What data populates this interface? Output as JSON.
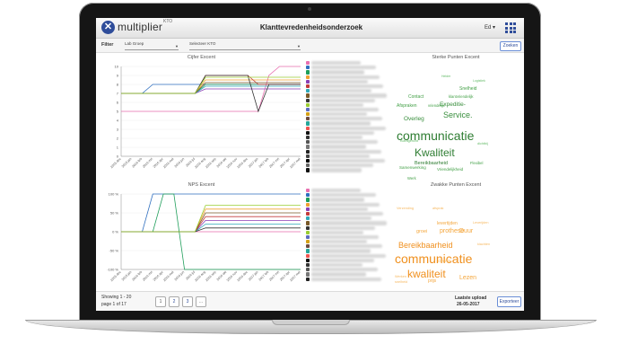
{
  "app": {
    "logo_letter": "✕",
    "logo_name": "multiplier",
    "logo_sup": "KTO",
    "title": "Klanttevredenheidsonderzoek",
    "user": "Ed ▾"
  },
  "filter": {
    "label": "Filter",
    "select1": "Lab Groep",
    "select2": "Selecteer KTO",
    "zoom_button": "Zoeken"
  },
  "panels": {
    "top_left_title": "Cijfer Excent",
    "top_right_title": "Sterke Punten Excent",
    "bottom_left_title": "NPS Excent",
    "bottom_right_title": "Zwakke Punten Excent"
  },
  "chart_data": [
    {
      "type": "line",
      "title": "Cijfer Excent",
      "x": [
        "2015 dec",
        "2015 jan",
        "2016 feb",
        "2016 mrt",
        "2016 apr",
        "2016 mei",
        "2016 jun",
        "2016 jul",
        "2016 aug",
        "2016 sep",
        "2016 okt",
        "2016 nov",
        "2016 dec",
        "2017 jan",
        "2017 feb",
        "2017 mrt",
        "2017 apr",
        "2017 mei"
      ],
      "ylim": [
        0,
        10
      ],
      "yticks": [
        "0",
        "1",
        "2",
        "3",
        "4",
        "5",
        "6",
        "7",
        "8",
        "9",
        "10"
      ],
      "series": [
        {
          "color": "#e86fb0",
          "values": [
            5,
            5,
            5,
            5,
            5,
            5,
            5,
            5,
            5,
            5,
            5,
            5,
            5,
            5,
            9,
            10,
            10,
            10
          ]
        },
        {
          "color": "#2f6fbf",
          "values": [
            7,
            7,
            7,
            8,
            8,
            8,
            8,
            8,
            8,
            8,
            8,
            8,
            8,
            8,
            8,
            8,
            8,
            8
          ]
        },
        {
          "color": "#1f9e5a",
          "values": [
            7,
            7,
            7,
            7,
            7,
            7,
            7,
            7,
            8,
            8,
            8,
            8,
            8,
            8,
            8,
            8,
            8,
            8
          ]
        },
        {
          "color": "#f0a030",
          "values": [
            7,
            7,
            7,
            7,
            7,
            7,
            7,
            7,
            8.5,
            8.5,
            8.5,
            8.5,
            8.5,
            8.5,
            8.5,
            8.5,
            8.5,
            8.5
          ]
        },
        {
          "color": "#8a3fb5",
          "values": [
            7,
            7,
            7,
            7,
            7,
            7,
            7,
            7,
            7.5,
            7.5,
            7.5,
            7.5,
            7.5,
            7.5,
            7.5,
            7.5,
            7.5,
            7.5
          ]
        },
        {
          "color": "#c23b3b",
          "values": [
            7,
            7,
            7,
            7,
            7,
            7,
            7,
            7,
            9,
            9,
            9,
            9,
            9,
            8,
            8,
            8,
            8,
            8
          ]
        },
        {
          "color": "#2fa8b8",
          "values": [
            7,
            7,
            7,
            7,
            7,
            7,
            7,
            7,
            7.8,
            7.8,
            7.8,
            7.8,
            7.8,
            7.8,
            7.8,
            7.8,
            7.8,
            7.8
          ]
        },
        {
          "color": "#7a5a2a",
          "values": [
            7,
            7,
            7,
            7,
            7,
            7,
            7,
            7,
            8.2,
            8.2,
            8.2,
            8.2,
            8.2,
            8.2,
            8.2,
            8.2,
            8.2,
            8.2
          ]
        },
        {
          "color": "#333333",
          "values": [
            7,
            7,
            7,
            7,
            7,
            7,
            7,
            7,
            9,
            9,
            9,
            9,
            9,
            5,
            8,
            8,
            8,
            8
          ]
        },
        {
          "color": "#9acd32",
          "values": [
            7,
            7,
            7,
            7,
            7,
            7,
            7,
            7,
            8.8,
            8.8,
            8.8,
            8.8,
            8.8,
            8.8,
            8.8,
            8.8,
            8.8,
            8.8
          ]
        }
      ]
    },
    {
      "type": "line",
      "title": "NPS Excent",
      "x": [
        "2015 dec",
        "2015 jan",
        "2016 feb",
        "2016 mrt",
        "2016 apr",
        "2016 mei",
        "2016 jun",
        "2016 jul",
        "2016 aug",
        "2016 sep",
        "2016 okt",
        "2016 nov",
        "2016 dec",
        "2017 jan",
        "2017 feb",
        "2017 mrt",
        "2017 apr",
        "2017 mei"
      ],
      "ylim": [
        -100,
        100
      ],
      "yticks": [
        "-100 %",
        "-50 %",
        "0 %",
        "50 %",
        "100 %"
      ],
      "series": [
        {
          "color": "#e86fb0",
          "values": [
            0,
            0,
            0,
            0,
            0,
            0,
            0,
            0,
            0,
            0,
            0,
            0,
            0,
            0,
            0,
            0,
            0,
            0
          ]
        },
        {
          "color": "#2f6fbf",
          "values": [
            0,
            0,
            0,
            100,
            100,
            100,
            100,
            100,
            100,
            100,
            100,
            100,
            100,
            100,
            100,
            100,
            100,
            100
          ]
        },
        {
          "color": "#1f9e5a",
          "values": [
            0,
            0,
            0,
            0,
            100,
            100,
            -100,
            -100,
            -100,
            -100,
            -100,
            -100,
            -100,
            -100,
            -100,
            -100,
            -100,
            -100
          ]
        },
        {
          "color": "#f0a030",
          "values": [
            0,
            0,
            0,
            0,
            0,
            0,
            0,
            0,
            60,
            60,
            60,
            60,
            60,
            60,
            60,
            60,
            60,
            60
          ]
        },
        {
          "color": "#8a3fb5",
          "values": [
            0,
            0,
            0,
            0,
            0,
            0,
            0,
            0,
            30,
            30,
            30,
            30,
            30,
            30,
            30,
            30,
            30,
            30
          ]
        },
        {
          "color": "#c23b3b",
          "values": [
            0,
            0,
            0,
            0,
            0,
            0,
            0,
            0,
            40,
            40,
            40,
            40,
            40,
            40,
            40,
            40,
            40,
            40
          ]
        },
        {
          "color": "#2fa8b8",
          "values": [
            0,
            0,
            0,
            0,
            0,
            0,
            0,
            0,
            20,
            20,
            20,
            20,
            20,
            20,
            20,
            20,
            20,
            20
          ]
        },
        {
          "color": "#7a5a2a",
          "values": [
            0,
            0,
            0,
            0,
            0,
            0,
            0,
            0,
            50,
            50,
            50,
            50,
            50,
            50,
            50,
            50,
            50,
            50
          ]
        },
        {
          "color": "#333333",
          "values": [
            0,
            0,
            0,
            0,
            0,
            0,
            0,
            0,
            10,
            10,
            10,
            10,
            10,
            10,
            10,
            10,
            10,
            10
          ]
        },
        {
          "color": "#9acd32",
          "values": [
            0,
            0,
            0,
            0,
            0,
            0,
            0,
            0,
            70,
            70,
            70,
            70,
            70,
            70,
            70,
            70,
            70,
            70
          ]
        }
      ]
    }
  ],
  "wordcloud_strong": [
    {
      "text": "communicatie",
      "size": 14,
      "color": "#2e7d32"
    },
    {
      "text": "Kwaliteit",
      "size": 12,
      "color": "#2e7d32"
    },
    {
      "text": "Service.",
      "size": 9,
      "color": "#388e3c"
    },
    {
      "text": "Expeditie-",
      "size": 6.5,
      "color": "#388e3c"
    },
    {
      "text": "Overleg",
      "size": 6.5,
      "color": "#388e3c"
    },
    {
      "text": "Contact",
      "size": 5,
      "color": "#43a047"
    },
    {
      "text": "Afspraken",
      "size": 5,
      "color": "#43a047"
    },
    {
      "text": "Snelheid",
      "size": 5,
      "color": "#43a047"
    },
    {
      "text": "klantvriendelijk",
      "size": 4.2,
      "color": "#43a047"
    },
    {
      "text": "vriendelijk",
      "size": 4.2,
      "color": "#43a047"
    },
    {
      "text": "Bereikbaarheid",
      "size": 5.5,
      "color": "#2e7d32"
    },
    {
      "text": "Samenwerking",
      "size": 4.5,
      "color": "#43a047"
    },
    {
      "text": "Vriendelijkheid",
      "size": 4.5,
      "color": "#43a047"
    },
    {
      "text": "Flexibel",
      "size": 4.2,
      "color": "#43a047"
    },
    {
      "text": "Werk",
      "size": 4.2,
      "color": "#43a047"
    },
    {
      "text": "Klantgericht",
      "size": 3.8,
      "color": "#66bb6a"
    },
    {
      "text": "dichtbij",
      "size": 3.8,
      "color": "#66bb6a"
    },
    {
      "text": "Logistiek",
      "size": 3.5,
      "color": "#66bb6a"
    },
    {
      "text": "Helder",
      "size": 3.5,
      "color": "#66bb6a"
    }
  ],
  "wordcloud_weak": [
    {
      "text": "communicatie",
      "size": 14,
      "color": "#f0901e"
    },
    {
      "text": "kwaliteit",
      "size": 12,
      "color": "#f0901e"
    },
    {
      "text": "Bereikbaarheid",
      "size": 9,
      "color": "#f0901e"
    },
    {
      "text": "prothese",
      "size": 7,
      "color": "#f4a63c"
    },
    {
      "text": "Lezen",
      "size": 7,
      "color": "#f4a63c"
    },
    {
      "text": "Duur",
      "size": 7,
      "color": "#f4a63c"
    },
    {
      "text": "groei",
      "size": 5.5,
      "color": "#f4a63c"
    },
    {
      "text": "levertijden",
      "size": 5,
      "color": "#f4a63c"
    },
    {
      "text": "prijs",
      "size": 5,
      "color": "#f4a63c"
    },
    {
      "text": "Overlig",
      "size": 4.5,
      "color": "#f6b860"
    },
    {
      "text": "Verzending",
      "size": 3.8,
      "color": "#f6b860"
    },
    {
      "text": "afsprak",
      "size": 3.8,
      "color": "#f6b860"
    },
    {
      "text": "Leverijden",
      "size": 3.8,
      "color": "#f6b860"
    },
    {
      "text": "Werken",
      "size": 3.8,
      "color": "#f6b860"
    },
    {
      "text": "klachten",
      "size": 3.8,
      "color": "#f6b860"
    },
    {
      "text": "snelheid",
      "size": 3.8,
      "color": "#f6b860"
    }
  ],
  "legend_colors": [
    "#e86fb0",
    "#2f6fbf",
    "#1f9e5a",
    "#f0a030",
    "#8a3fb5",
    "#c23b3b",
    "#2fa8b8",
    "#7a5a2a",
    "#333333",
    "#9acd32",
    "#5c6bc0",
    "#d4a017",
    "#6d4c41",
    "#26a69a",
    "#ef5350",
    "#111111",
    "#333333",
    "#555555",
    "#777777",
    "#222222",
    "#444444",
    "#000000",
    "#666666",
    "#111111",
    "#333333",
    "#555555"
  ],
  "footer": {
    "showing": "Showing 1 - 20",
    "page": "page 1 of 17",
    "pages": [
      "1",
      "2",
      "3",
      "..."
    ],
    "upload_label": "Laatste upload",
    "upload_date": "26-05-2017",
    "export_button": "Exporteer"
  }
}
